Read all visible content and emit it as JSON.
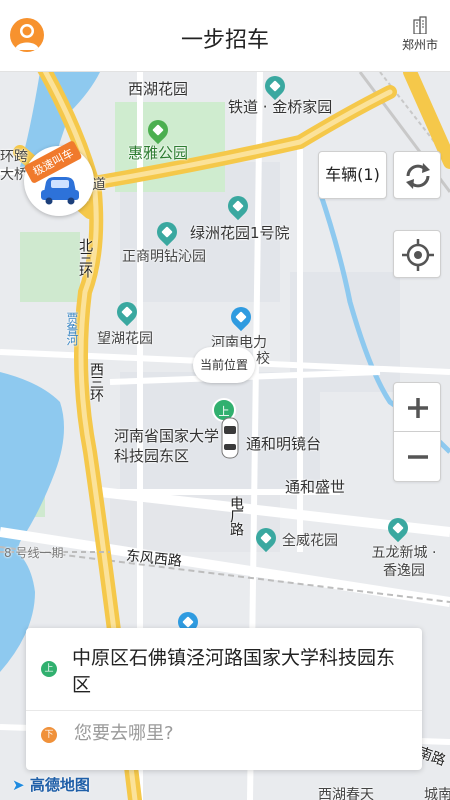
{
  "header": {
    "title": "一步招车",
    "city": "郑州市"
  },
  "map": {
    "labels": {
      "xihu_garden": "西湖花园",
      "tiedao_jinqiao": "铁道 · 金桥家园",
      "huiya_park": "惠雅公园",
      "huanqiao_left": "环跨",
      "daqiao_left": "大桥",
      "dao_left": "道",
      "luzhou_hospital": "绿洲花园1号院",
      "zhengshang": "正商明钻沁园",
      "beisanhuan": "北三环",
      "jialu_river": "贾鲁河",
      "wanghu_garden": "望湖花园",
      "henan_power": "河南电力",
      "henan_power_suffix": "校",
      "xisanhuan": "西三环",
      "henan_science": "河南省国家大学科技园东区",
      "tonghe_mingjing": "通和明镜台",
      "tonghe_shengshi": "通和盛世",
      "dianchang_road": "电厂路",
      "quanwei_garden": "全威花园",
      "dongfeng_road": "东风西路",
      "wulong": "五龙新城 · 香逸园",
      "metro8": "8 号线一期",
      "xihu_chuntian": "西湖春天",
      "chengnan": "城南",
      "nanlu": "南路"
    },
    "current_position": "当前位置",
    "start_badge": "上",
    "fast_badge": "极速叫车"
  },
  "controls": {
    "vehicles": "车辆(1)"
  },
  "panel": {
    "from_badge": "上",
    "from_text": "中原区石佛镇泾河路国家大学科技园东区",
    "to_badge": "下",
    "to_placeholder": "您要去哪里?"
  },
  "footer": {
    "map_logo": "高德地图"
  },
  "colors": {
    "accent_orange": "#f07a2c",
    "start_green": "#31b06f",
    "highway_yellow": "#f5c84a",
    "water_blue": "#8ec9ef",
    "park_green": "#b7e3b8"
  }
}
